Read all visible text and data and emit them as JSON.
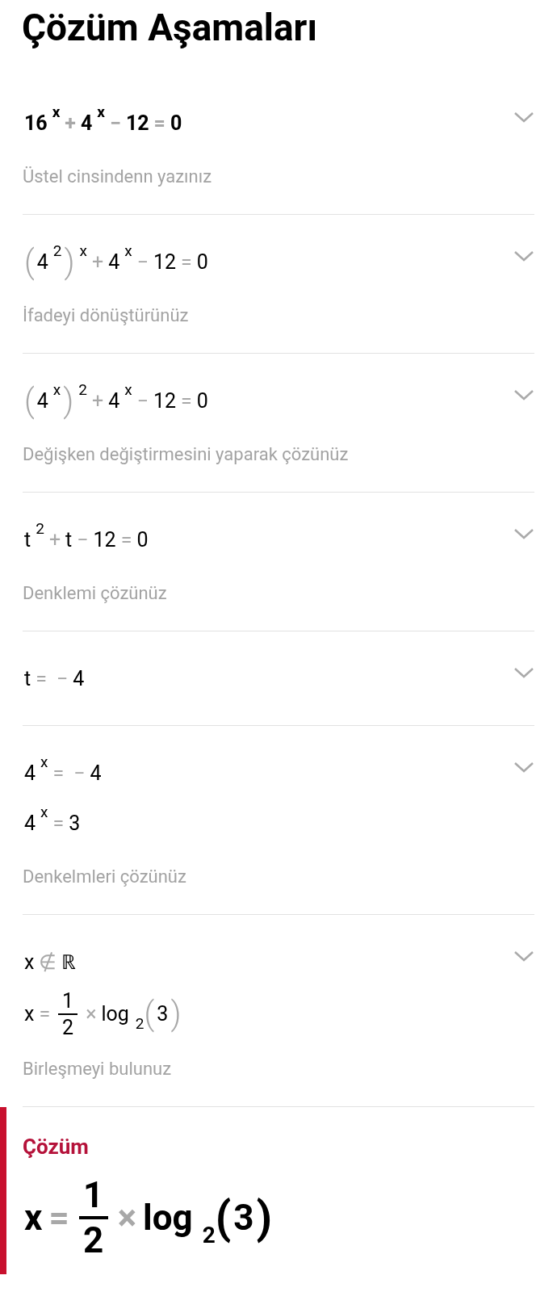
{
  "title": "Çözüm Aşamaları",
  "steps": [
    {
      "bold": true,
      "lines": [
        [
          {
            "kind": "text",
            "text": "16"
          },
          {
            "kind": "sup",
            "text": "x"
          },
          {
            "kind": "op",
            "text": "+"
          },
          {
            "kind": "text",
            "text": "4"
          },
          {
            "kind": "sup",
            "text": "x"
          },
          {
            "kind": "op",
            "text": "−"
          },
          {
            "kind": "text",
            "text": "12"
          },
          {
            "kind": "op",
            "text": "="
          },
          {
            "kind": "text",
            "text": "0"
          }
        ]
      ],
      "caption": "Üstel cinsindenn yazınız"
    },
    {
      "bold": false,
      "lines": [
        [
          {
            "kind": "group",
            "open": "(",
            "close": ")",
            "children": [
              {
                "kind": "text",
                "text": "4"
              },
              {
                "kind": "sup",
                "text": "2"
              }
            ]
          },
          {
            "kind": "sup",
            "text": "x"
          },
          {
            "kind": "op",
            "text": "+"
          },
          {
            "kind": "text",
            "text": "4"
          },
          {
            "kind": "sup",
            "text": "x"
          },
          {
            "kind": "op",
            "text": "−"
          },
          {
            "kind": "text",
            "text": "12"
          },
          {
            "kind": "op",
            "text": "="
          },
          {
            "kind": "text",
            "text": "0"
          }
        ]
      ],
      "caption": "İfadeyi dönüştürünüz"
    },
    {
      "bold": false,
      "lines": [
        [
          {
            "kind": "group",
            "open": "(",
            "close": ")",
            "children": [
              {
                "kind": "text",
                "text": "4"
              },
              {
                "kind": "sup",
                "text": "x"
              }
            ]
          },
          {
            "kind": "sup",
            "text": "2"
          },
          {
            "kind": "op",
            "text": "+"
          },
          {
            "kind": "text",
            "text": "4"
          },
          {
            "kind": "sup",
            "text": "x"
          },
          {
            "kind": "op",
            "text": "−"
          },
          {
            "kind": "text",
            "text": "12"
          },
          {
            "kind": "op",
            "text": "="
          },
          {
            "kind": "text",
            "text": "0"
          }
        ]
      ],
      "caption": "Değişken değiştirmesini yaparak çözünüz"
    },
    {
      "bold": false,
      "lines": [
        [
          {
            "kind": "text",
            "text": "t"
          },
          {
            "kind": "sup",
            "text": "2"
          },
          {
            "kind": "op",
            "text": "+"
          },
          {
            "kind": "text",
            "text": "t"
          },
          {
            "kind": "op",
            "text": "−"
          },
          {
            "kind": "text",
            "text": "12"
          },
          {
            "kind": "op",
            "text": "="
          },
          {
            "kind": "text",
            "text": "0"
          }
        ]
      ],
      "caption": "Denklemi çözünüz"
    },
    {
      "bold": false,
      "lines": [
        [
          {
            "kind": "text",
            "text": "t"
          },
          {
            "kind": "op",
            "text": "="
          },
          {
            "kind": "op",
            "text": "−"
          },
          {
            "kind": "text",
            "text": "4"
          }
        ]
      ]
    },
    {
      "bold": false,
      "lines": [
        [
          {
            "kind": "text",
            "text": "4"
          },
          {
            "kind": "sup",
            "text": "x"
          },
          {
            "kind": "op",
            "text": "="
          },
          {
            "kind": "op",
            "text": "−"
          },
          {
            "kind": "text",
            "text": "4"
          }
        ],
        [
          {
            "kind": "text",
            "text": "4"
          },
          {
            "kind": "sup",
            "text": "x"
          },
          {
            "kind": "op",
            "text": "="
          },
          {
            "kind": "text",
            "text": "3"
          }
        ]
      ],
      "caption": "Denkelmleri çözünüz"
    },
    {
      "bold": false,
      "lines": [
        [
          {
            "kind": "text",
            "text": "x"
          },
          {
            "kind": "op",
            "text": "∉"
          },
          {
            "kind": "text",
            "text": "ℝ"
          }
        ],
        [
          {
            "kind": "text",
            "text": "x"
          },
          {
            "kind": "op",
            "text": "="
          },
          {
            "kind": "frac",
            "num": "1",
            "den": "2"
          },
          {
            "kind": "op",
            "text": "×"
          },
          {
            "kind": "text",
            "text": "log"
          },
          {
            "kind": "sub",
            "text": "2"
          },
          {
            "kind": "group",
            "open": "(",
            "close": ")",
            "children": [
              {
                "kind": "text",
                "text": "3"
              }
            ]
          }
        ]
      ],
      "caption": "Birleşmeyi bulunuz"
    }
  ],
  "solution": {
    "label": "Çözüm",
    "line": [
      {
        "kind": "text",
        "text": "x"
      },
      {
        "kind": "op",
        "text": "="
      },
      {
        "kind": "frac",
        "num": "1",
        "den": "2"
      },
      {
        "kind": "op",
        "text": "×"
      },
      {
        "kind": "text",
        "text": "log"
      },
      {
        "kind": "sub",
        "text": "2"
      },
      {
        "kind": "group",
        "open": "(",
        "close": ")",
        "children": [
          {
            "kind": "text",
            "text": "3"
          }
        ]
      }
    ]
  }
}
